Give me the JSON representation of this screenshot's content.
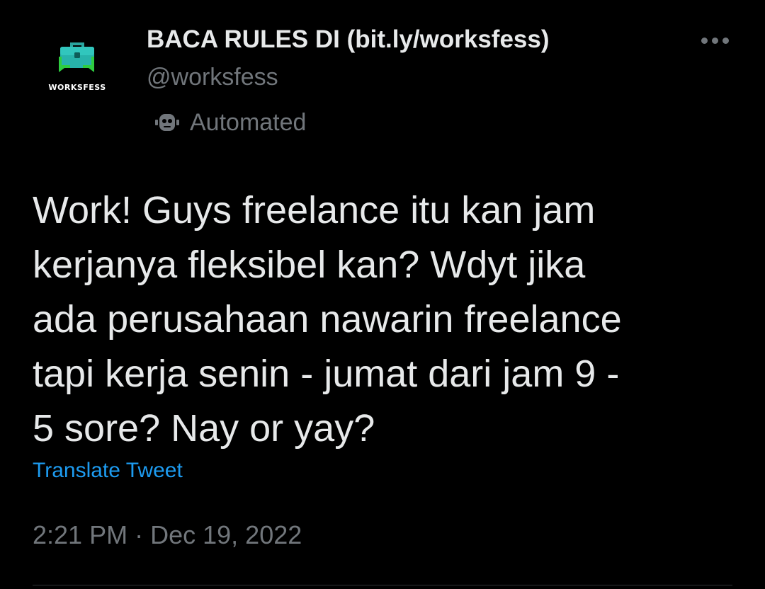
{
  "author": {
    "display_name": "BACA RULES DI (bit.ly/worksfess)",
    "handle": "@worksfess",
    "avatar_text": "WORKSFESS",
    "label": "Automated"
  },
  "tweet": {
    "lines": [
      "Work! Guys freelance itu kan jam",
      "kerjanya fleksibel kan? Wdyt jika",
      "ada perusahaan nawarin freelance",
      "tapi kerja senin - jumat dari jam 9 -",
      "5 sore? Nay or yay?"
    ],
    "translate_label": "Translate Tweet",
    "time": "2:21 PM",
    "separator": "·",
    "date": "Dec 19, 2022"
  },
  "icons": {
    "avatar": "briefcase-chat-icon",
    "more": "more-horizontal-icon",
    "automated": "robot-icon"
  },
  "colors": {
    "background": "#000000",
    "text": "#e7e9ea",
    "secondary": "#71767b",
    "link": "#1d9bf0",
    "avatar_teal": "#20b2aa",
    "avatar_green": "#2ecc40"
  }
}
